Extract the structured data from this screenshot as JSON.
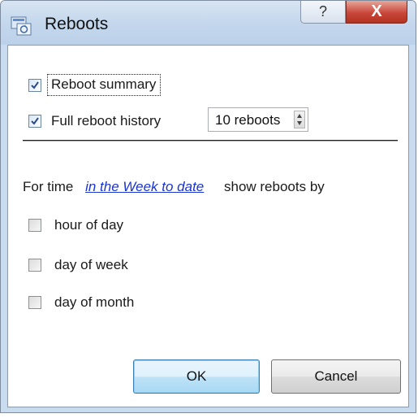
{
  "window": {
    "title": "Reboots",
    "help_symbol": "?",
    "close_symbol": "X"
  },
  "options": {
    "reboot_summary": {
      "label": "Reboot summary",
      "checked": true
    },
    "full_history": {
      "label": "Full reboot history",
      "checked": true,
      "value": "10 reboots"
    }
  },
  "filter": {
    "prefix": "For time",
    "link": "in the Week to date",
    "suffix": "show reboots by",
    "items": [
      {
        "label": "hour of day",
        "checked": false
      },
      {
        "label": "day of week",
        "checked": false
      },
      {
        "label": "day of month",
        "checked": false
      }
    ]
  },
  "buttons": {
    "ok": "OK",
    "cancel": "Cancel"
  },
  "colors": {
    "titlebar": "#c3d6ec",
    "link": "#1a34d6",
    "close": "#c9473a"
  }
}
